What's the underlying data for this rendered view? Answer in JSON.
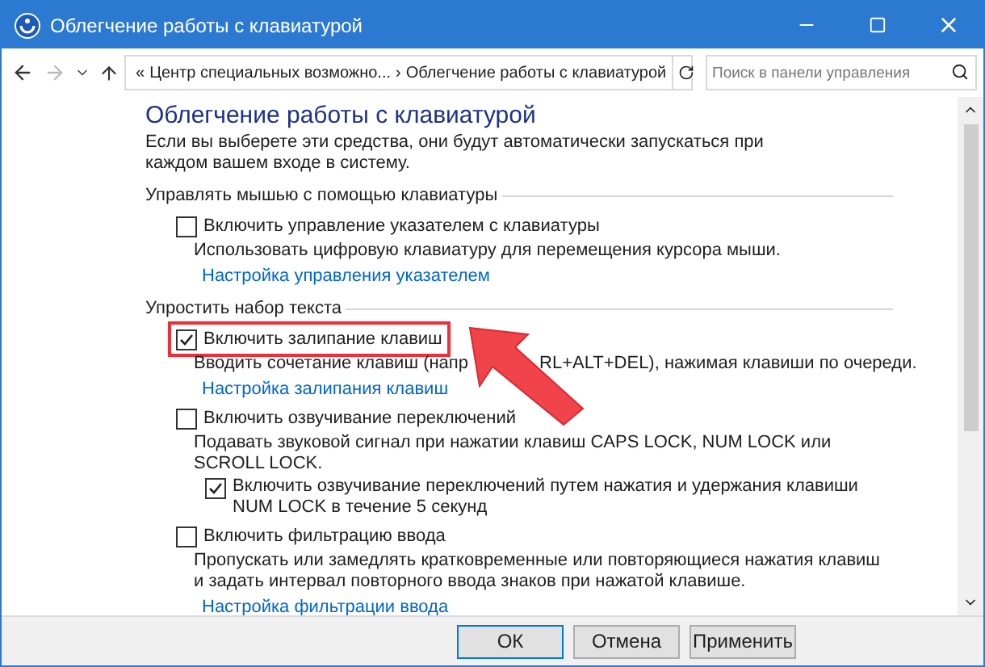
{
  "window": {
    "title": "Облегчение работы с клавиатурой"
  },
  "address_bar": {
    "crumbs": [
      "«",
      "Центр специальных возможно...",
      "›",
      "Облегчение работы с клавиатурой"
    ]
  },
  "search": {
    "placeholder": "Поиск в панели управления"
  },
  "content": {
    "heading": "Облегчение работы с клавиатурой",
    "intro": "Если вы выберете эти средства, они будут автоматически запускаться при каждом вашем входе в систему.",
    "sections": [
      {
        "heading": "Управлять мышью с помощью клавиатуры",
        "options": [
          {
            "label": "Включить управление указателем с клавиатуры",
            "checked": false,
            "highlighted": false,
            "description": [
              "Использовать цифровую клавиатуру для перемещения курсора мыши."
            ],
            "link": "Настройка управления указателем"
          }
        ]
      },
      {
        "heading": "Упростить набор текста",
        "options": [
          {
            "label": "Включить залипание клавиш",
            "checked": true,
            "highlighted": true,
            "description": [
              "Вводить сочетание клавиш (напр",
              "RL+ALT+DEL), нажимая клавиши по очереди."
            ],
            "link": "Настройка залипания клавиш"
          },
          {
            "label": "Включить озвучивание переключений",
            "checked": false,
            "highlighted": false,
            "description": [
              "Подавать звуковой сигнал при нажатии клавиш CAPS LOCK, NUM LOCK или SCROLL LOCK."
            ],
            "suboption": {
              "label": "Включить озвучивание переключений путем нажатия и удержания клавиши NUM LOCK в течение 5 секунд",
              "checked": true
            }
          },
          {
            "label": "Включить фильтрацию ввода",
            "checked": false,
            "highlighted": false,
            "description": [
              "Пропускать или замедлять кратковременные или повторяющиеся нажатия клавиш и задать интервал повторного ввода знаков при нажатой клавише."
            ],
            "link": "Настройка фильтрации ввода"
          }
        ]
      }
    ]
  },
  "buttons": [
    {
      "label": "ОК",
      "default": true
    },
    {
      "label": "Отмена",
      "default": false
    },
    {
      "label": "Применить",
      "default": false
    }
  ]
}
